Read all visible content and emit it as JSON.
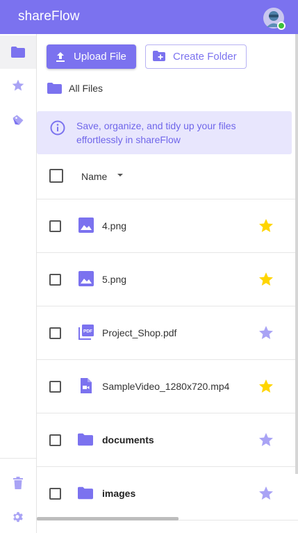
{
  "app": {
    "title": "shareFlow"
  },
  "colors": {
    "primary": "#7b72ef",
    "banner_bg": "#e8e6fd",
    "star_on": "#ffd500",
    "star_off": "#a9a3f5"
  },
  "sidebar": {
    "items": [
      {
        "icon": "folder-icon",
        "active": true
      },
      {
        "icon": "star-icon",
        "active": false
      },
      {
        "icon": "tag-icon",
        "active": false
      }
    ],
    "bottom": [
      {
        "icon": "trash-icon"
      },
      {
        "icon": "gear-icon"
      }
    ]
  },
  "toolbar": {
    "upload_label": "Upload File",
    "create_folder_label": "Create Folder"
  },
  "breadcrumb": {
    "label": "All Files"
  },
  "banner": {
    "text": "Save, organize, and tidy up your files effortlessly in shareFlow"
  },
  "table": {
    "header": {
      "name_label": "Name",
      "sort_icon": "caret-down-icon"
    },
    "rows": [
      {
        "name": "4.png",
        "type": "image",
        "starred": true
      },
      {
        "name": "5.png",
        "type": "image",
        "starred": true
      },
      {
        "name": "Project_Shop.pdf",
        "type": "pdf",
        "starred": false
      },
      {
        "name": "SampleVideo_1280x720.mp4",
        "type": "video",
        "starred": true
      },
      {
        "name": "documents",
        "type": "folder",
        "starred": false
      },
      {
        "name": "images",
        "type": "folder",
        "starred": false
      }
    ]
  }
}
